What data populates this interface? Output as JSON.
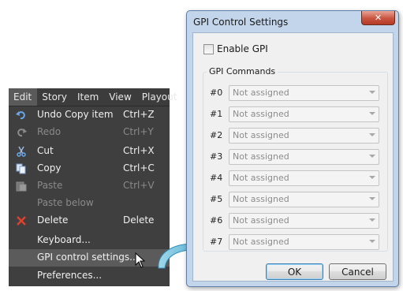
{
  "menubar": {
    "items": [
      {
        "label": "Edit",
        "active": true
      },
      {
        "label": "Story",
        "active": false
      },
      {
        "label": "Item",
        "active": false
      },
      {
        "label": "View",
        "active": false
      },
      {
        "label": "Playout",
        "active": false
      }
    ]
  },
  "edit_menu": {
    "items": [
      {
        "label": "Undo Copy item",
        "shortcut": "Ctrl+Z",
        "icon": "undo-icon",
        "disabled": false
      },
      {
        "label": "Redo",
        "shortcut": "Ctrl+Y",
        "icon": "redo-icon",
        "disabled": true
      },
      {
        "label": "Cut",
        "shortcut": "Ctrl+X",
        "icon": "scissors-icon",
        "disabled": false
      },
      {
        "label": "Copy",
        "shortcut": "Ctrl+C",
        "icon": "copy-icon",
        "disabled": false
      },
      {
        "label": "Paste",
        "shortcut": "Ctrl+V",
        "icon": "paste-icon",
        "disabled": true
      },
      {
        "label": "Paste below",
        "shortcut": "",
        "icon": "",
        "disabled": true
      },
      {
        "label": "Delete",
        "shortcut": "Delete",
        "icon": "delete-x-icon",
        "disabled": false
      },
      {
        "label": "Keyboard...",
        "shortcut": "",
        "icon": "",
        "disabled": false
      },
      {
        "label": "GPI control settings...",
        "shortcut": "",
        "icon": "",
        "disabled": false,
        "highlighted": true
      },
      {
        "label": "Preferences...",
        "shortcut": "",
        "icon": "",
        "disabled": false
      }
    ]
  },
  "dialog": {
    "title": "GPI Control Settings",
    "close_glyph": "✕",
    "enable_label": "Enable GPI",
    "enable_checked": false,
    "group_label": "GPI Commands",
    "commands": [
      {
        "num": "#0",
        "value": "Not assigned"
      },
      {
        "num": "#1",
        "value": "Not assigned"
      },
      {
        "num": "#2",
        "value": "Not assigned"
      },
      {
        "num": "#3",
        "value": "Not assigned"
      },
      {
        "num": "#4",
        "value": "Not assigned"
      },
      {
        "num": "#5",
        "value": "Not assigned"
      },
      {
        "num": "#6",
        "value": "Not assigned"
      },
      {
        "num": "#7",
        "value": "Not assigned"
      }
    ],
    "ok_label": "OK",
    "cancel_label": "Cancel"
  },
  "colors": {
    "menu_bg": "#3f3f3f",
    "menu_highlight": "#5b5b5b",
    "dialog_frame": "#c3d5ea",
    "close_red": "#c85440",
    "callout_arrow": "#5fb6d6"
  }
}
